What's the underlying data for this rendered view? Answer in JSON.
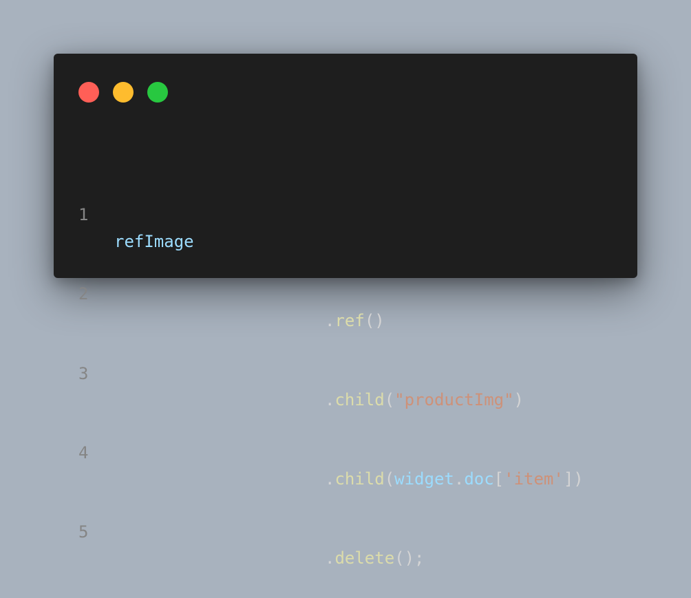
{
  "window": {
    "controls": [
      {
        "name": "close",
        "color": "#ff5f57"
      },
      {
        "name": "minimize",
        "color": "#febc2e"
      },
      {
        "name": "maximize",
        "color": "#28c840"
      }
    ]
  },
  "colors": {
    "background": "#a8b2be",
    "editor_bg": "#1e1e1e",
    "line_number": "#858585",
    "variable": "#9cdcfe",
    "function": "#dcdcaa",
    "string": "#ce9178",
    "punctuation": "#d4d4d4"
  },
  "code": {
    "lines": [
      {
        "number": "1",
        "tokens": {
          "t1": "refImage"
        }
      },
      {
        "number": "2",
        "tokens": {
          "t1": ".",
          "t2": "ref",
          "t3": "()"
        }
      },
      {
        "number": "3",
        "tokens": {
          "t1": ".",
          "t2": "child",
          "t3": "(",
          "t4": "\"productImg\"",
          "t5": ")"
        }
      },
      {
        "number": "4",
        "tokens": {
          "t1": ".",
          "t2": "child",
          "t3": "(",
          "t4": "widget",
          "t5": ".",
          "t6": "doc",
          "t7": "[",
          "t8": "'item'",
          "t9": "])"
        }
      },
      {
        "number": "5",
        "tokens": {
          "t1": ".",
          "t2": "delete",
          "t3": "();"
        }
      }
    ]
  }
}
